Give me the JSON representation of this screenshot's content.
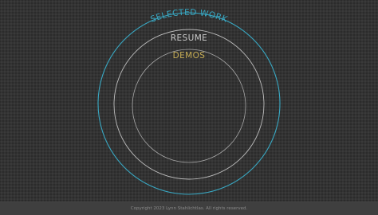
{
  "nav": {
    "outer": {
      "label": "SELECTED WORK",
      "color": "#39a9c4"
    },
    "middle": {
      "label": "RESUME",
      "color": "#c9c9c9"
    },
    "inner": {
      "label": "DEMOS",
      "color": "#c7ad55"
    }
  },
  "footer": {
    "copyright": "Copyright 2023 Lynn Stahlichtlas. All rights reserved."
  }
}
